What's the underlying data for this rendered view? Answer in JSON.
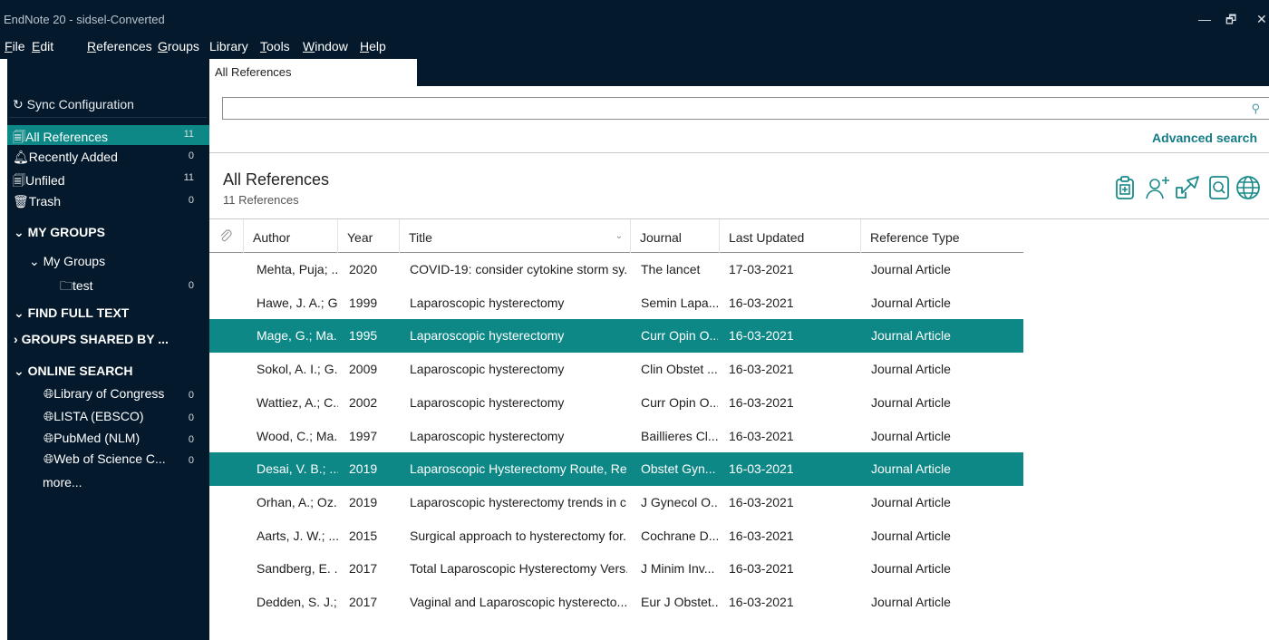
{
  "window": {
    "title": "EndNote 20 - sidsel-Converted",
    "minimize": "—",
    "maximize": "🗗",
    "close": "✕"
  },
  "menu": [
    {
      "label": "File",
      "ul": "F",
      "rest": "ile"
    },
    {
      "label": "Edit",
      "ul": "E",
      "rest": "dit"
    },
    {
      "label": "References",
      "ul": "R",
      "rest": "eferences"
    },
    {
      "label": "Groups",
      "ul": "G",
      "rest": "roups"
    },
    {
      "label": "Library",
      "ul": "",
      "rest": "Library"
    },
    {
      "label": "Tools",
      "ul": "T",
      "rest": "ools"
    },
    {
      "label": "Window",
      "ul": "W",
      "rest": "indow"
    },
    {
      "label": "Help",
      "ul": "H",
      "rest": "elp"
    }
  ],
  "tabs": [
    {
      "label": "All References"
    }
  ],
  "sidebar": {
    "sync_label": "Sync Configuration",
    "items": [
      {
        "label": "All References",
        "count": "11"
      },
      {
        "label": "Recently Added",
        "count": "0"
      },
      {
        "label": "Unfiled",
        "count": "11"
      },
      {
        "label": "Trash",
        "count": "0"
      }
    ],
    "my_groups_header": "MY GROUPS",
    "my_groups_sub": "My Groups",
    "group_test": {
      "label": "test",
      "count": "0"
    },
    "find_full_text_header": "FIND FULL TEXT",
    "groups_shared_header": "GROUPS SHARED BY ...",
    "online_search_header": "ONLINE SEARCH",
    "online_items": [
      {
        "label": "Library of Congress",
        "count": "0"
      },
      {
        "label": "LISTA (EBSCO)",
        "count": "0"
      },
      {
        "label": "PubMed (NLM)",
        "count": "0"
      },
      {
        "label": "Web of Science C...",
        "count": "0"
      }
    ],
    "more_label": "more..."
  },
  "search": {
    "placeholder": "",
    "value": "",
    "advanced_label": "Advanced search"
  },
  "library": {
    "title": "All References",
    "subtitle": "11 References"
  },
  "toolbar_icons": [
    "insert-citation-icon",
    "add-user-icon",
    "share-icon",
    "find-fulltext-icon",
    "online-search-icon"
  ],
  "table": {
    "columns": [
      "Author",
      "Year",
      "Title",
      "Journal",
      "Last Updated",
      "Reference Type"
    ],
    "rows": [
      {
        "author": "Mehta, Puja; ...",
        "year": "2020",
        "title": "COVID-19: consider cytokine storm sy...",
        "journal": "The lancet",
        "updated": "17-03-2021",
        "type": "Journal Article",
        "selected": false
      },
      {
        "author": "Hawe, J. A.; G...",
        "year": "1999",
        "title": "Laparoscopic hysterectomy",
        "journal": "Semin Lapa...",
        "updated": "16-03-2021",
        "type": "Journal Article",
        "selected": false
      },
      {
        "author": "Mage, G.; Ma...",
        "year": "1995",
        "title": "Laparoscopic hysterectomy",
        "journal": "Curr Opin O...",
        "updated": "16-03-2021",
        "type": "Journal Article",
        "selected": true
      },
      {
        "author": "Sokol, A. I.; G...",
        "year": "2009",
        "title": "Laparoscopic hysterectomy",
        "journal": "Clin Obstet ...",
        "updated": "16-03-2021",
        "type": "Journal Article",
        "selected": false
      },
      {
        "author": "Wattiez, A.; C...",
        "year": "2002",
        "title": "Laparoscopic hysterectomy",
        "journal": "Curr Opin O...",
        "updated": "16-03-2021",
        "type": "Journal Article",
        "selected": false
      },
      {
        "author": "Wood, C.; Ma...",
        "year": "1997",
        "title": "Laparoscopic hysterectomy",
        "journal": "Baillieres Cl...",
        "updated": "16-03-2021",
        "type": "Journal Article",
        "selected": false
      },
      {
        "author": "Desai, V. B.; ...",
        "year": "2019",
        "title": "Laparoscopic Hysterectomy Route, Re...",
        "journal": "Obstet Gyn...",
        "updated": "16-03-2021",
        "type": "Journal Article",
        "selected": true
      },
      {
        "author": "Orhan, A.; Oz...",
        "year": "2019",
        "title": "Laparoscopic hysterectomy trends in c...",
        "journal": "J Gynecol O...",
        "updated": "16-03-2021",
        "type": "Journal Article",
        "selected": false
      },
      {
        "author": "Aarts, J. W.; ...",
        "year": "2015",
        "title": "Surgical approach to hysterectomy for...",
        "journal": "Cochrane D...",
        "updated": "16-03-2021",
        "type": "Journal Article",
        "selected": false
      },
      {
        "author": "Sandberg, E. ...",
        "year": "2017",
        "title": "Total Laparoscopic Hysterectomy Vers...",
        "journal": "J Minim Inv...",
        "updated": "16-03-2021",
        "type": "Journal Article",
        "selected": false
      },
      {
        "author": "Dedden, S. J.;...",
        "year": "2017",
        "title": "Vaginal and Laparoscopic hysterecto...",
        "journal": "Eur J Obstet...",
        "updated": "16-03-2021",
        "type": "Journal Article",
        "selected": false
      }
    ]
  },
  "colors": {
    "dark": "#04192c",
    "accent": "#0d8886",
    "link": "#137c86",
    "icon": "#1a8a8a"
  }
}
